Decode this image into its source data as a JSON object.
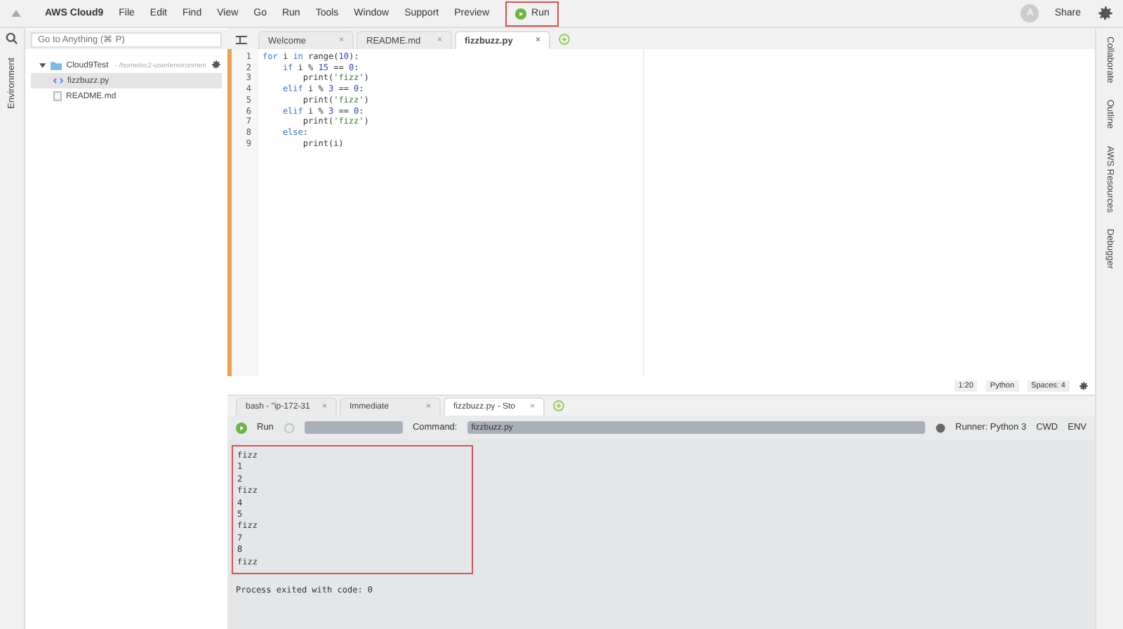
{
  "menu_bar": {
    "logo": "AWS Cloud9",
    "items": [
      "File",
      "Edit",
      "Find",
      "View",
      "Go",
      "Run",
      "Tools",
      "Window",
      "Support"
    ],
    "preview": "Preview",
    "run_button": {
      "label": "Run",
      "highlighted": true
    },
    "avatar": "A",
    "share": "Share"
  },
  "left_panel": {
    "tab": "Environment",
    "search": {
      "placeholder": "Go to Anything (⌘ P)"
    },
    "tree": [
      {
        "name": "Cloud9Test",
        "path": " - /home/ec2-user/environmen",
        "kind": "folder",
        "expanded": true,
        "selected": false,
        "children": [
          {
            "name": "fizzbuzz.py",
            "kind": "python",
            "selected": true
          },
          {
            "name": "README.md",
            "kind": "file",
            "selected": false
          }
        ]
      }
    ]
  },
  "editor": {
    "tabs": [
      {
        "label": "Welcome",
        "close": "×",
        "selected": false
      },
      {
        "label": "README.md",
        "close": "×",
        "selected": false
      },
      {
        "label": "fizzbuzz.py",
        "close": "×",
        "selected": true
      }
    ],
    "lines": [
      [
        {
          "keyword": "for"
        },
        {
          "plain": " i "
        },
        {
          "keyword": "in"
        },
        {
          "plain": " range("
        },
        {
          "number": "10"
        },
        {
          "plain": "):"
        }
      ],
      [
        {
          "keyword": "    if"
        },
        {
          "plain": " i % "
        },
        {
          "number": "15"
        },
        {
          "plain": " == "
        },
        {
          "number": "0"
        },
        {
          "plain": ":"
        }
      ],
      [
        {
          "plain": "        print("
        },
        {
          "string": "'fizz'"
        },
        {
          "plain": ")"
        }
      ],
      [
        {
          "keyword": "    elif"
        },
        {
          "plain": " i % "
        },
        {
          "number": "3"
        },
        {
          "plain": " == "
        },
        {
          "number": "0"
        },
        {
          "plain": ":"
        }
      ],
      [
        {
          "plain": "        print("
        },
        {
          "string": "'fizz'"
        },
        {
          "plain": ")"
        }
      ],
      [
        {
          "keyword": "    elif"
        },
        {
          "plain": " i % "
        },
        {
          "number": "3"
        },
        {
          "plain": " == "
        },
        {
          "number": "0"
        },
        {
          "plain": ":"
        }
      ],
      [
        {
          "plain": "        print("
        },
        {
          "string": "'fizz'"
        },
        {
          "plain": ")"
        }
      ],
      [
        {
          "keyword": "    else"
        },
        {
          "plain": ":"
        }
      ],
      [
        {
          "plain": "        print(i)"
        }
      ]
    ],
    "line_numbers": [
      "1",
      "2",
      "3",
      "4",
      "5",
      "6",
      "7",
      "8",
      "9"
    ],
    "status": {
      "position": "1:20",
      "language": "Python",
      "spaces": "Spaces: 4"
    }
  },
  "right_panel": {
    "tabs": [
      "Collaborate",
      "Outline",
      "AWS Resources",
      "Debugger"
    ]
  },
  "terminal": {
    "tabs": [
      {
        "label": "bash - \"ip-172-31",
        "close": "×",
        "selected": false
      },
      {
        "label": "Immediate",
        "close": "×",
        "selected": false
      },
      {
        "label": "fizzbuzz.py - Sto",
        "close": "×",
        "selected": true
      }
    ],
    "run": "Run",
    "command_label": "Command:",
    "command": "fizzbuzz.py",
    "runner": "Runner: Python 3",
    "cwd": "CWD",
    "env": "ENV",
    "output": {
      "lines": [
        "fizz",
        "1",
        "2",
        "fizz",
        "4",
        "5",
        "fizz",
        "7",
        "8",
        "fizz"
      ],
      "highlighted": true
    },
    "exit_message": "Process exited with code: 0"
  }
}
